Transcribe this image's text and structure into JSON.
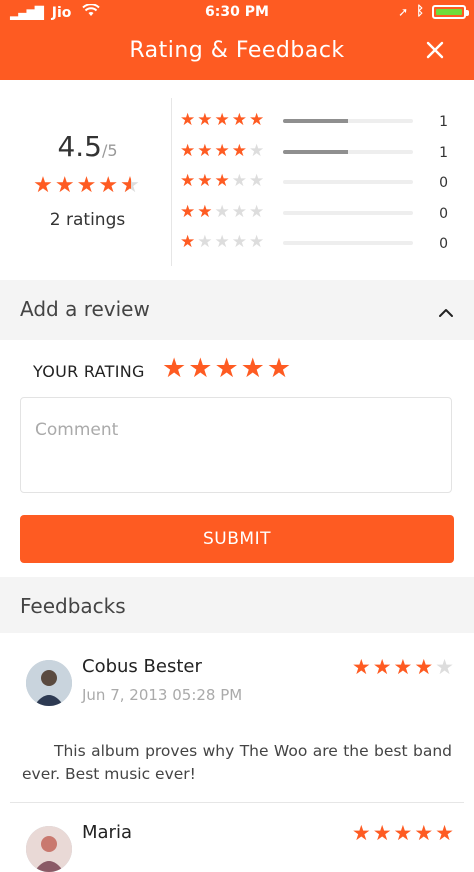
{
  "status_bar": {
    "carrier": "Jio",
    "time": "6:30 PM"
  },
  "header": {
    "title": "Rating & Feedback",
    "close_icon": "close-icon"
  },
  "summary": {
    "average": "4.5",
    "out_of": "/5",
    "average_value": 4.5,
    "ratings_count_text": "2 ratings",
    "distribution": [
      {
        "stars": 5,
        "count": "1",
        "fraction": 0.5
      },
      {
        "stars": 4,
        "count": "1",
        "fraction": 0.5
      },
      {
        "stars": 3,
        "count": "0",
        "fraction": 0
      },
      {
        "stars": 2,
        "count": "0",
        "fraction": 0
      },
      {
        "stars": 1,
        "count": "0",
        "fraction": 0
      }
    ]
  },
  "add_review": {
    "section_label": "Add a review",
    "your_rating_label": "YOUR RATING",
    "selected_rating": 5,
    "comment_placeholder": "Comment",
    "submit_label": "SUBMIT"
  },
  "feedbacks": {
    "section_label": "Feedbacks",
    "items": [
      {
        "name": "Cobus Bester",
        "date": "Jun 7, 2013 05:28 PM",
        "rating": 4,
        "text": "This album proves why The Woo are the best band ever. Best music ever!"
      },
      {
        "name": "Maria",
        "date": "",
        "rating": 5,
        "text": ""
      }
    ]
  },
  "colors": {
    "accent": "#fe5b22",
    "section_bg": "#f4f4f4"
  }
}
